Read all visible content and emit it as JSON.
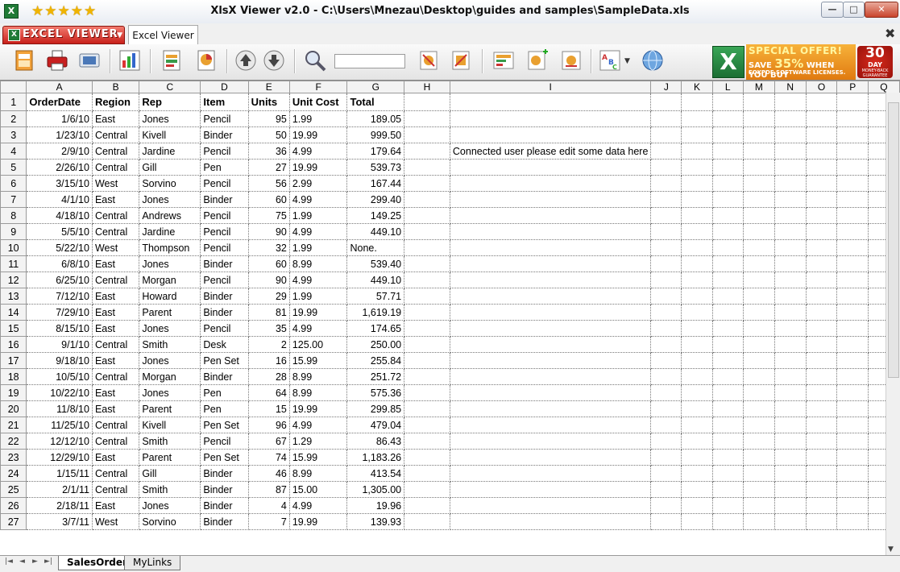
{
  "window": {
    "title": "XlsX Viewer v2.0 - C:\\Users\\Mnezau\\Desktop\\guides and samples\\SampleData.xls",
    "rating_stars": "★★★★★",
    "app_icon_letter": "X",
    "minimize": "—",
    "maximize": "□",
    "close": "✕"
  },
  "tabs": {
    "logo_letter": "X",
    "logo_text": "EXCEL VIEWER",
    "document_tab": "Excel Viewer",
    "close_glyph": "✖"
  },
  "toolbar": {
    "icons": [
      "open-excel-icon",
      "print-icon",
      "print-preview-icon",
      "chart-icon",
      "insert-sheet-icon",
      "export-chart-icon",
      "move-up-icon",
      "move-down-icon",
      "search-icon",
      "search-input",
      "remove-sheet-icon",
      "clear-filter-icon",
      "format-icon",
      "add-sheet-icon",
      "sheet-options-icon",
      "spelling-icon",
      "globe-icon"
    ],
    "search_value": "",
    "excel_logo_letter": "X",
    "promo": {
      "line1": "SPECIAL OFFER!",
      "line2_prefix": "SAVE",
      "line2_pct": "35%",
      "line2_suffix": "WHEN YOU BUY",
      "line3": "FOXPDF SOFTWARE LICENSES."
    },
    "badge": {
      "days": "30",
      "unit": "DAY",
      "note": "MONEY-BACK GUARANTEE"
    }
  },
  "sheet": {
    "columns": [
      "A",
      "B",
      "C",
      "D",
      "E",
      "F",
      "G",
      "H",
      "I",
      "J",
      "K",
      "L",
      "M",
      "N",
      "O",
      "P",
      "Q"
    ],
    "header_row": [
      "OrderDate",
      "Region",
      "Rep",
      "Item",
      "Units",
      "Unit Cost",
      "Total"
    ],
    "rows": [
      [
        "1/6/10",
        "East",
        "Jones",
        "Pencil",
        "95",
        "1.99",
        "189.05"
      ],
      [
        "1/23/10",
        "Central",
        "Kivell",
        "Binder",
        "50",
        "19.99",
        "999.50"
      ],
      [
        "2/9/10",
        "Central",
        "Jardine",
        "Pencil",
        "36",
        "4.99",
        "179.64"
      ],
      [
        "2/26/10",
        "Central",
        "Gill",
        "Pen",
        "27",
        "19.99",
        "539.73"
      ],
      [
        "3/15/10",
        "West",
        "Sorvino",
        "Pencil",
        "56",
        "2.99",
        "167.44"
      ],
      [
        "4/1/10",
        "East",
        "Jones",
        "Binder",
        "60",
        "4.99",
        "299.40"
      ],
      [
        "4/18/10",
        "Central",
        "Andrews",
        "Pencil",
        "75",
        "1.99",
        "149.25"
      ],
      [
        "5/5/10",
        "Central",
        "Jardine",
        "Pencil",
        "90",
        "4.99",
        "449.10"
      ],
      [
        "5/22/10",
        "West",
        "Thompson",
        "Pencil",
        "32",
        "1.99",
        "None."
      ],
      [
        "6/8/10",
        "East",
        "Jones",
        "Binder",
        "60",
        "8.99",
        "539.40"
      ],
      [
        "6/25/10",
        "Central",
        "Morgan",
        "Pencil",
        "90",
        "4.99",
        "449.10"
      ],
      [
        "7/12/10",
        "East",
        "Howard",
        "Binder",
        "29",
        "1.99",
        "57.71"
      ],
      [
        "7/29/10",
        "East",
        "Parent",
        "Binder",
        "81",
        "19.99",
        "1,619.19"
      ],
      [
        "8/15/10",
        "East",
        "Jones",
        "Pencil",
        "35",
        "4.99",
        "174.65"
      ],
      [
        "9/1/10",
        "Central",
        "Smith",
        "Desk",
        "2",
        "125.00",
        "250.00"
      ],
      [
        "9/18/10",
        "East",
        "Jones",
        "Pen Set",
        "16",
        "15.99",
        "255.84"
      ],
      [
        "10/5/10",
        "Central",
        "Morgan",
        "Binder",
        "28",
        "8.99",
        "251.72"
      ],
      [
        "10/22/10",
        "East",
        "Jones",
        "Pen",
        "64",
        "8.99",
        "575.36"
      ],
      [
        "11/8/10",
        "East",
        "Parent",
        "Pen",
        "15",
        "19.99",
        "299.85"
      ],
      [
        "11/25/10",
        "Central",
        "Kivell",
        "Pen Set",
        "96",
        "4.99",
        "479.04"
      ],
      [
        "12/12/10",
        "Central",
        "Smith",
        "Pencil",
        "67",
        "1.29",
        "86.43"
      ],
      [
        "12/29/10",
        "East",
        "Parent",
        "Pen Set",
        "74",
        "15.99",
        "1,183.26"
      ],
      [
        "1/15/11",
        "Central",
        "Gill",
        "Binder",
        "46",
        "8.99",
        "413.54"
      ],
      [
        "2/1/11",
        "Central",
        "Smith",
        "Binder",
        "87",
        "15.00",
        "1,305.00"
      ],
      [
        "2/18/11",
        "East",
        "Jones",
        "Binder",
        "4",
        "4.99",
        "19.96"
      ],
      [
        "3/7/11",
        "West",
        "Sorvino",
        "Binder",
        "7",
        "19.99",
        "139.93"
      ]
    ],
    "note_cell": {
      "row": 4,
      "column": "I",
      "text": "Connected user please edit some data here"
    }
  },
  "sheet_tabs": {
    "nav": [
      "|◄",
      "◄",
      "►",
      "►|"
    ],
    "tabs": [
      "SalesOrders",
      "MyLinks"
    ],
    "active": "SalesOrders"
  }
}
